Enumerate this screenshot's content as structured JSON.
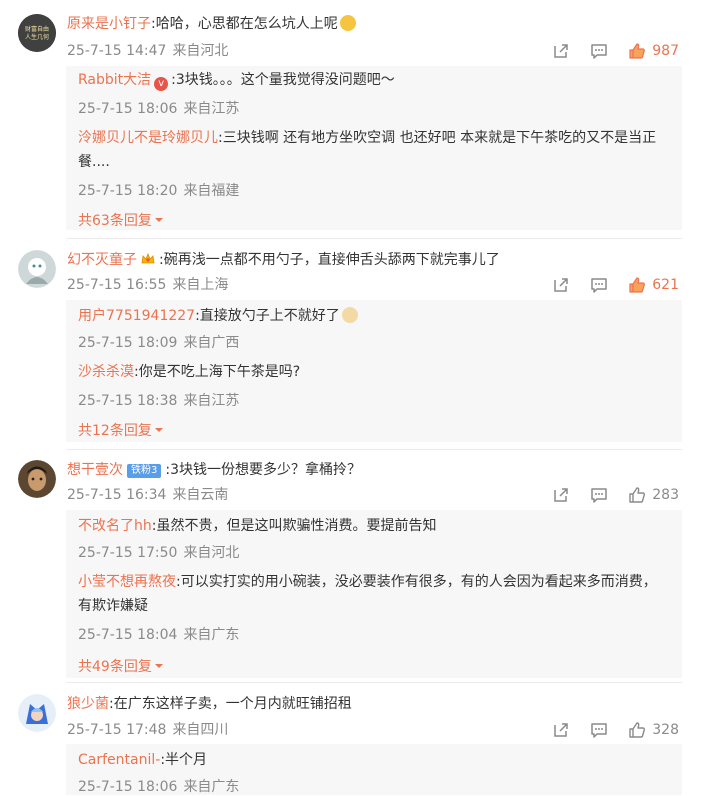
{
  "comments": [
    {
      "user": "原来是小钉子",
      "text": ":哈哈，心思都在怎么坑人上呢",
      "time": "25-7-15 14:47",
      "location": "来自河北",
      "likes": "987",
      "avatar_text": "财富自由人生几何",
      "replies": [
        {
          "user": "Rabbit大洁",
          "text": ":3块钱。。。这个量我觉得没问题吧～",
          "time": "25-7-15 18:06",
          "location": "来自江苏"
        },
        {
          "user": "泠娜贝儿不是玲娜贝儿",
          "text_line1": ":三块钱啊  还有地方坐吹空调 也还好吧 本来就是下午茶吃的又不是当正",
          "text_line2": "餐....",
          "time": "25-7-15 18:20",
          "location": "来自福建"
        }
      ],
      "more": "共63条回复"
    },
    {
      "user": "幻不灭童子",
      "text": ":碗再浅一点都不用勺子，直接伸舌头舔两下就完事儿了",
      "time": "25-7-15 16:55",
      "location": "来自上海",
      "likes": "621",
      "replies": [
        {
          "user": "用户7751941227",
          "text": ":直接放勺子上不就好了",
          "time": "25-7-15 18:09",
          "location": "来自广西"
        },
        {
          "user": "沙杀杀漠",
          "text": ":你是不吃上海下午茶是吗?",
          "time": "25-7-15 18:38",
          "location": "来自江苏"
        }
      ],
      "more": "共12条回复"
    },
    {
      "user": "想干壹次",
      "badge": "铁粉3",
      "text": ":3块钱一份想要多少？拿桶拎？",
      "time": "25-7-15 16:34",
      "location": "来自云南",
      "likes": "283",
      "replies": [
        {
          "user": "不改名了hh",
          "text": ":虽然不贵，但是这叫欺骗性消费。要提前告知",
          "time": "25-7-15 17:50",
          "location": "来自河北"
        },
        {
          "user": "小莹不想再熬夜",
          "text_line1": ":可以实打实的用小碗装，没必要装作有很多，有的人会因为看起来多而消费，",
          "text_line2": "有欺诈嫌疑",
          "time": "25-7-15 18:04",
          "location": "来自广东"
        }
      ],
      "more": "共49条回复"
    },
    {
      "user": "狼少菌",
      "text": ":在广东这样子卖，一个月内就旺铺招租",
      "time": "25-7-15 17:48",
      "location": "来自四川",
      "likes": "328",
      "replies": [
        {
          "user": "Carfentanil-",
          "text": ":半个月",
          "time": "25-7-15 18:06",
          "location": "来自广东"
        }
      ]
    }
  ],
  "colors": {
    "accent": "#eb7350",
    "meta": "#8a8a8a",
    "reply_bg": "#f7f7f7"
  }
}
